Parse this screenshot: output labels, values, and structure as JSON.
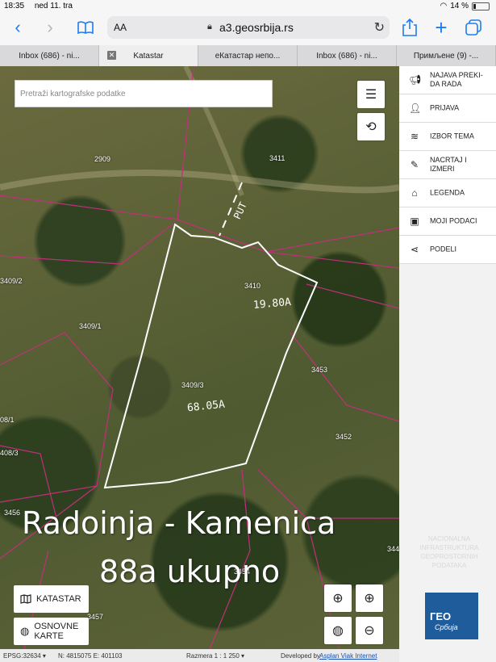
{
  "status": {
    "time": "18:35",
    "date": "ned 11. tra",
    "battery": "14 %",
    "battery_level": 0.14
  },
  "toolbar": {
    "aa": "AA",
    "url": "a3.geosrbija.rs"
  },
  "tabs": [
    "Inbox (686) - ni...",
    "Katastar",
    "eКатастар непо...",
    "Inbox (686) - ni...",
    "Примљене (9) -..."
  ],
  "map": {
    "search_placeholder": "Pretraži kartografske podatke",
    "parcels": [
      "2909",
      "3411",
      "3409/2",
      "3410",
      "3409/1",
      "3453",
      "3409/3",
      "08/1",
      "3452",
      "408/3",
      "3456",
      "344",
      "3454",
      "3457"
    ],
    "annotations": {
      "put": "PUT",
      "area1": "19.80A",
      "area2": "68.05A"
    },
    "caption_line1": "Radoinja - Kamenica",
    "caption_line2": "88a ukupno",
    "katastar_btn": "KATASTAR",
    "osnovne_btn_1": "OSNOVNE",
    "osnovne_btn_2": "KARTE"
  },
  "footer": {
    "epsg": "EPSG:32634 ▾",
    "coords": "N: 4815075 E: 401103",
    "scale": "Razmera 1 : 1 250 ▾",
    "dev_prefix": "Developed by",
    "dev_link": "Asplan Viak Internet"
  },
  "side": {
    "items": [
      {
        "label": "NAJAVA PREKI-\nDA RADA",
        "icon": "megaphone-icon"
      },
      {
        "label": "PRIJAVA",
        "icon": "user-icon"
      },
      {
        "label": "IZBOR TEMA",
        "icon": "layers-icon"
      },
      {
        "label": "NACRTAJ I\nIZMERI",
        "icon": "pencil-icon"
      },
      {
        "label": "LEGENDA",
        "icon": "tag-icon"
      },
      {
        "label": "MOJI PODACI",
        "icon": "briefcase-icon"
      },
      {
        "label": "PODELI",
        "icon": "share-icon"
      }
    ],
    "nat_text": "NACIONALNA INFRASTRUKTURA GEOPROSTORNIH PODATAKA",
    "geo_logo_1": "ГЕО",
    "geo_logo_2": "Србија"
  }
}
